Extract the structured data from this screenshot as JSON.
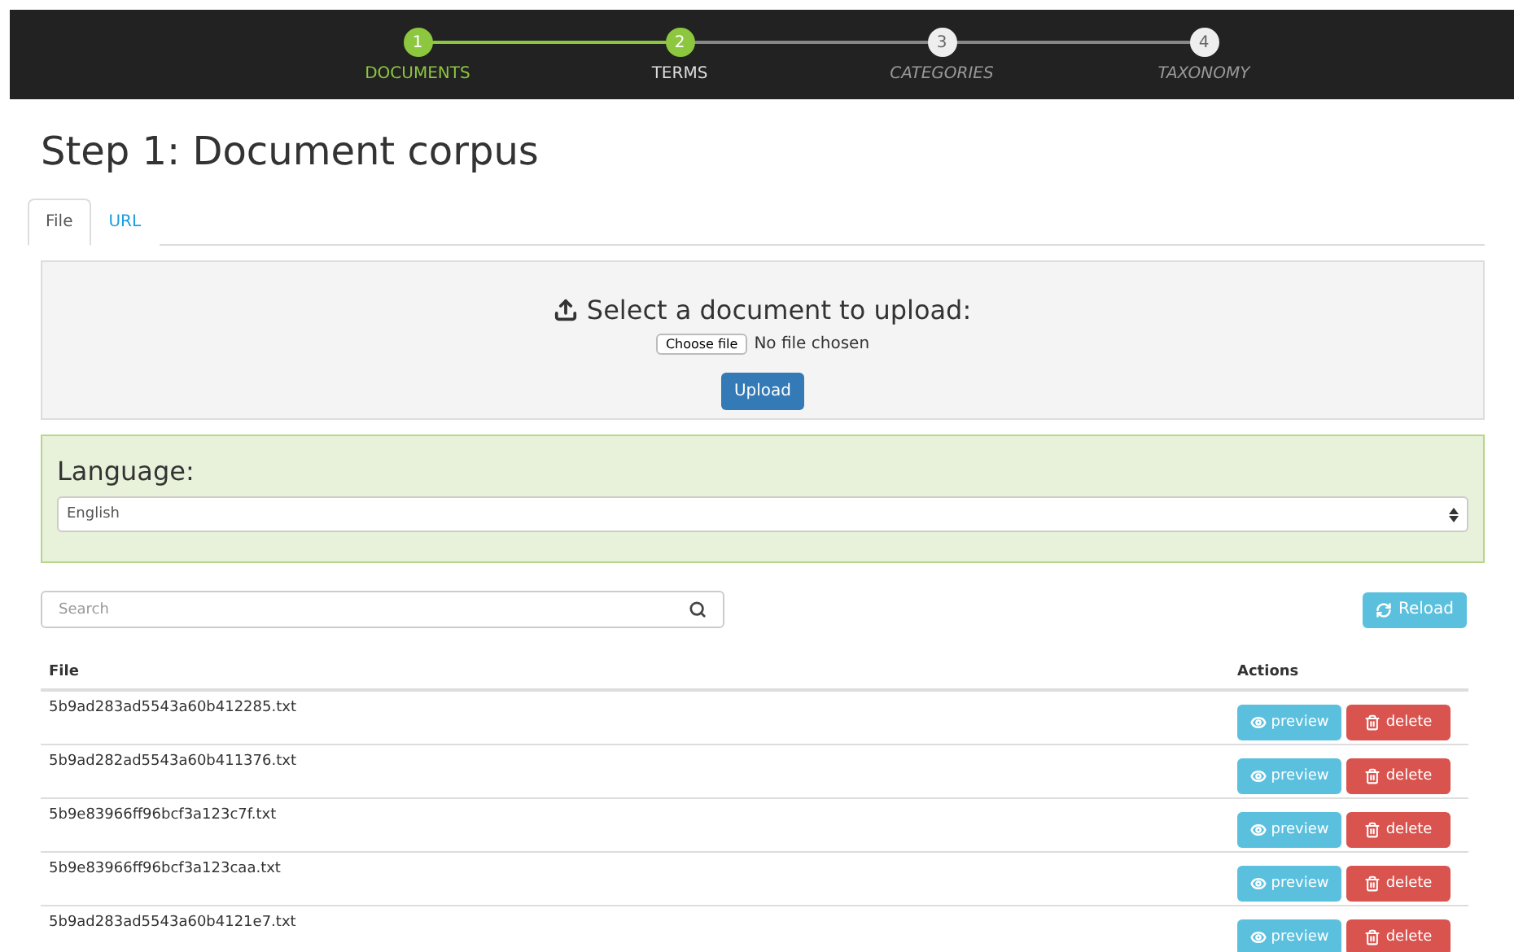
{
  "steps": [
    {
      "number": "1",
      "label": "DOCUMENTS",
      "done": true,
      "selected": true
    },
    {
      "number": "2",
      "label": "TERMS",
      "done": true,
      "selected": false
    },
    {
      "number": "3",
      "label": "CATEGORIES",
      "done": false,
      "selected": false
    },
    {
      "number": "4",
      "label": "TAXONOMY",
      "done": false,
      "selected": false
    }
  ],
  "title": "Step 1: Document corpus",
  "tabs": [
    {
      "label": "File",
      "selected": true
    },
    {
      "label": "URL",
      "selected": false
    }
  ],
  "upload": {
    "heading": "Select a document to upload:",
    "choose_button": "Choose file",
    "file_status": "No file chosen",
    "upload_button": "Upload"
  },
  "language": {
    "label": "Language:",
    "value": "English"
  },
  "search": {
    "placeholder": "Search"
  },
  "reload_button": "Reload",
  "table": {
    "columns": [
      "File",
      "Actions"
    ],
    "rows": [
      {
        "file": "5b9ad283ad5543a60b412285.txt",
        "preview": "preview",
        "delete": "delete"
      },
      {
        "file": "5b9ad282ad5543a60b411376.txt",
        "preview": "preview",
        "delete": "delete"
      },
      {
        "file": "5b9e83966ff96bcf3a123c7f.txt",
        "preview": "preview",
        "delete": "delete"
      },
      {
        "file": "5b9e83966ff96bcf3a123caa.txt",
        "preview": "preview",
        "delete": "delete"
      },
      {
        "file": "5b9ad283ad5543a60b4121e7.txt",
        "preview": "preview",
        "delete": "delete"
      }
    ]
  }
}
